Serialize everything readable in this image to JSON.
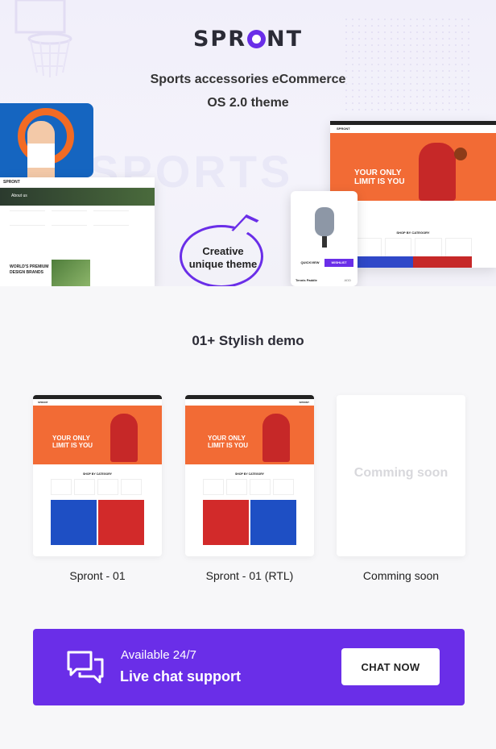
{
  "brand": {
    "logo_left": "SPR",
    "logo_right": "NT",
    "accent": "#6a2ee8"
  },
  "hero": {
    "tagline_line1": "Sports accessories eCommerce",
    "tagline_line2": "OS 2.0 theme",
    "bubble_line1": "Creative",
    "bubble_line2": "unique theme",
    "watermark": "SPORTS",
    "about_screen": {
      "nav_logo": "SPRONT",
      "banner_title": "About us",
      "brands_title_line1": "WORLD'S PREMIUM",
      "brands_title_line2": "DESIGN BRANDS"
    },
    "shop_screen": {
      "nav_logo": "SPRONT",
      "headline_line1": "YOUR ONLY",
      "headline_line2": "LIMIT IS YOU",
      "category_title": "SHOP BY CATEGORY"
    },
    "quickview": {
      "quickview_label": "QUICKVIEW",
      "wishlist_label": "WISHLIST",
      "product_name": "Tennis Paddle",
      "add_label": "ADD"
    }
  },
  "demos": {
    "title": "01+ Stylish demo",
    "items": [
      {
        "label": "Spront - 01",
        "headline_line1": "YOUR ONLY",
        "headline_line2": "LIMIT IS YOU",
        "category_title": "SHOP BY CATEGORY",
        "nav_logo": "SPRONT"
      },
      {
        "label": "Spront  - 01 (RTL)",
        "headline_line1": "YOUR ONLY",
        "headline_line2": "LIMIT IS YOU",
        "category_title": "SHOP BY CATEGORY",
        "nav_logo": "SPRONT"
      },
      {
        "label": "Comming soon",
        "placeholder_text": "Comming soon"
      }
    ]
  },
  "chat": {
    "availability": "Available 24/7",
    "title": "Live chat support",
    "button_label": "CHAT NOW",
    "icon": "chat-bubbles-icon"
  }
}
